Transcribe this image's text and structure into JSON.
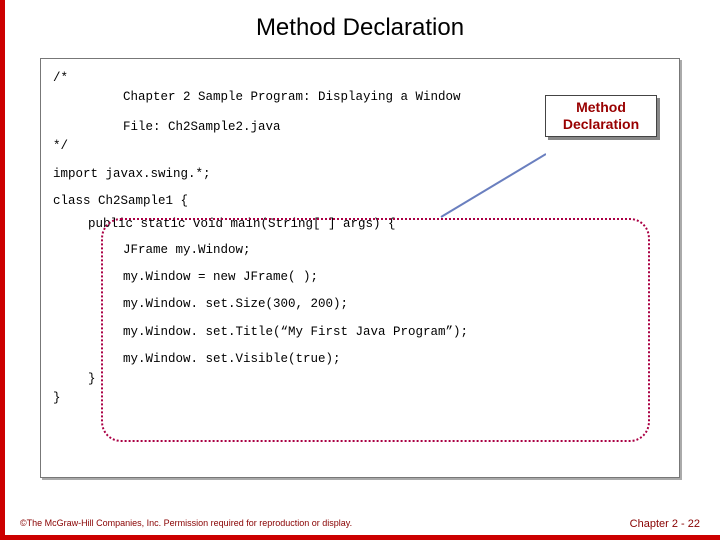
{
  "title": "Method Declaration",
  "code": {
    "c_open": "/*",
    "c_l1": "Chapter 2 Sample Program: Displaying a Window",
    "c_l2": "File: Ch2Sample2.java",
    "c_close": "*/",
    "import": "import javax.swing.*;",
    "class_decl": "class Ch2Sample1 {",
    "main_sig": "public static void main(String[ ] args) {",
    "l1": "JFrame    my.Window;",
    "l2": "my.Window = new JFrame( );",
    "l3": "my.Window. set.Size(300, 200);",
    "l4": "my.Window. set.Title(“My First Java Program”);",
    "l5": "my.Window. set.Visible(true);",
    "close1": "}",
    "close2": "}"
  },
  "callout": {
    "line1": "Method",
    "line2": "Declaration"
  },
  "footer": {
    "copyright": "©The McGraw-Hill Companies, Inc. Permission required for reproduction or display.",
    "page": "Chapter 2 - 22"
  }
}
